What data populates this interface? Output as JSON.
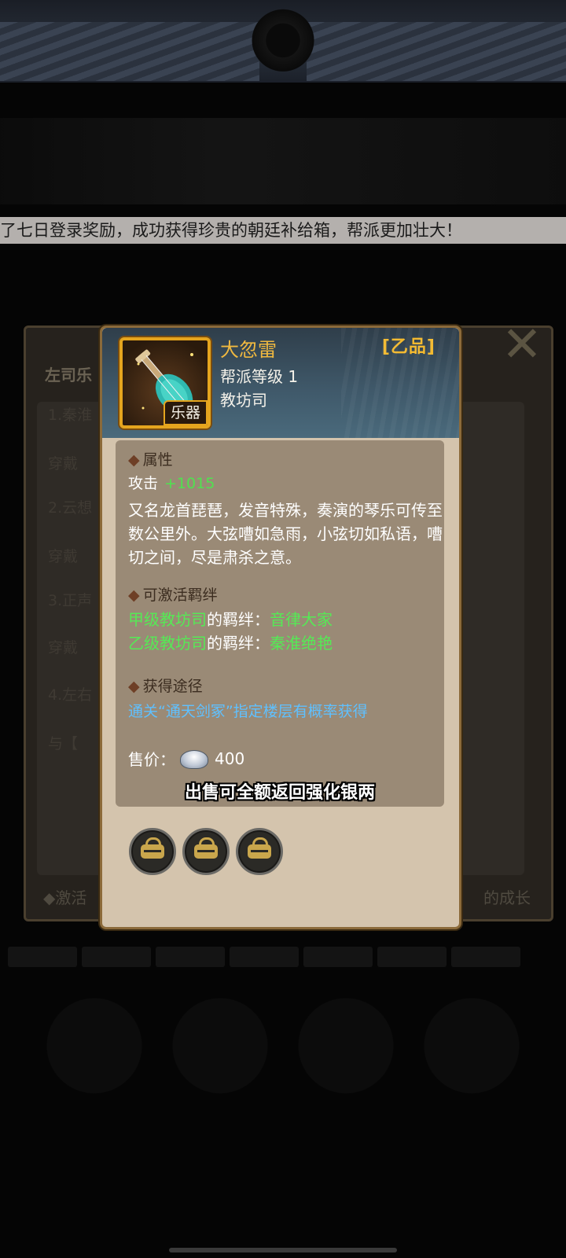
{
  "background": {
    "marquee_text": "了七日登录奖励，成功获得珍贵的朝廷补给箱，帮派更加壮大！",
    "panel_title": "左司乐",
    "rows": [
      {
        "label": "1.秦淮"
      },
      {
        "label": "穿戴"
      },
      {
        "label": "2.云想"
      },
      {
        "label": "穿戴"
      },
      {
        "label": "3.正声"
      },
      {
        "label": "穿戴"
      },
      {
        "label": "4.左右"
      },
      {
        "label": "与【"
      }
    ],
    "footer_left": "◆激活",
    "footer_right": "的成长"
  },
  "item": {
    "name": "大忽雷",
    "quality": "[乙品]",
    "level": "帮派等级 1",
    "category": "教坊司",
    "type_tag": "乐器",
    "icon": "pipa-instrument-icon"
  },
  "attributes": {
    "title": "属性",
    "stat_name": "攻击",
    "stat_value": "+1015",
    "description": "又名龙首琵琶，发音特殊，奏演的琴乐可传至数公里外。大弦嘈如急雨，小弦切如私语，嘈切之间，尽是肃杀之意。"
  },
  "bonds": {
    "title": "可激活羁绊",
    "items": [
      {
        "source": "甲级教坊司",
        "mid": "的羁绊：",
        "name": "音律大家"
      },
      {
        "source": "乙级教坊司",
        "mid": "的羁绊：",
        "name": "秦淮绝艳"
      }
    ]
  },
  "acquire": {
    "title": "获得途径",
    "text": "通关“通天剑冢”指定楼层有概率获得"
  },
  "price": {
    "label": "售价：",
    "value": "400",
    "icon": "silver-ingot-icon",
    "note": "出售可全额返回强化银两"
  },
  "slots": [
    {
      "icon": "lock-icon"
    },
    {
      "icon": "lock-icon"
    },
    {
      "icon": "lock-icon"
    }
  ],
  "colors": {
    "gold": "#f0b940",
    "green": "#4fe24f",
    "blue_link": "#5fc0ff",
    "popup_bg": "#d4c4ad",
    "info_bg": "#9a8a76"
  }
}
